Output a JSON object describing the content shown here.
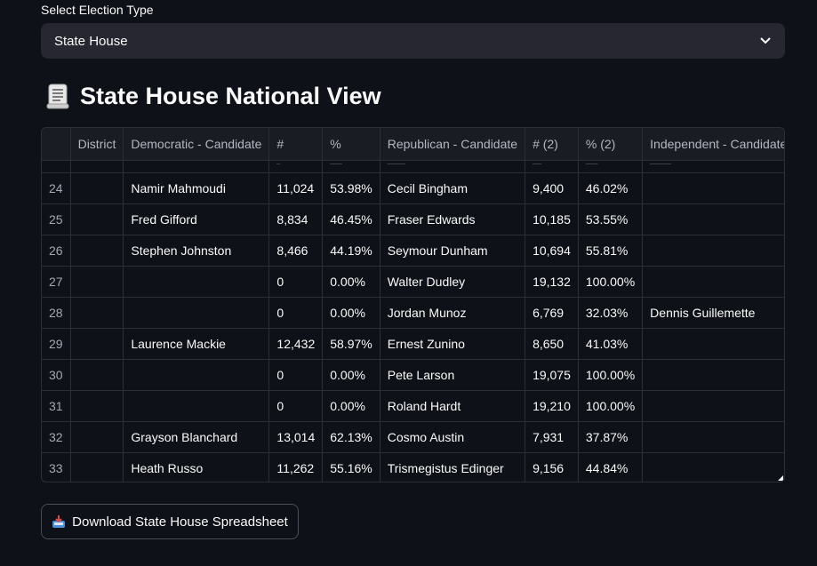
{
  "election_select": {
    "label": "Select Election Type",
    "value": "State House",
    "icon": "chevron-down-icon"
  },
  "heading": {
    "icon": "scroll-icon",
    "title": "State House National View"
  },
  "table": {
    "columns": [
      "",
      "District",
      "Democratic - Candidate",
      "#",
      "%",
      "Republican - Candidate",
      "# (2)",
      "% (2)",
      "Independent - Candidate"
    ],
    "rows": [
      {
        "idx": "24",
        "district": "",
        "dem": "Namir Mahmoudi",
        "dem_n": "11,024",
        "dem_p": "53.98%",
        "rep": "Cecil Bingham",
        "rep_n": "9,400",
        "rep_p": "46.02%",
        "ind": ""
      },
      {
        "idx": "25",
        "district": "",
        "dem": "Fred Gifford",
        "dem_n": "8,834",
        "dem_p": "46.45%",
        "rep": "Fraser Edwards",
        "rep_n": "10,185",
        "rep_p": "53.55%",
        "ind": ""
      },
      {
        "idx": "26",
        "district": "",
        "dem": "Stephen Johnston",
        "dem_n": "8,466",
        "dem_p": "44.19%",
        "rep": "Seymour Dunham",
        "rep_n": "10,694",
        "rep_p": "55.81%",
        "ind": ""
      },
      {
        "idx": "27",
        "district": "",
        "dem": "",
        "dem_n": "0",
        "dem_p": "0.00%",
        "rep": "Walter Dudley",
        "rep_n": "19,132",
        "rep_p": "100.00%",
        "ind": ""
      },
      {
        "idx": "28",
        "district": "",
        "dem": "",
        "dem_n": "0",
        "dem_p": "0.00%",
        "rep": "Jordan Munoz",
        "rep_n": "6,769",
        "rep_p": "32.03%",
        "ind": "Dennis Guillemette"
      },
      {
        "idx": "29",
        "district": "",
        "dem": "Laurence Mackie",
        "dem_n": "12,432",
        "dem_p": "58.97%",
        "rep": "Ernest Zunino",
        "rep_n": "8,650",
        "rep_p": "41.03%",
        "ind": ""
      },
      {
        "idx": "30",
        "district": "",
        "dem": "",
        "dem_n": "0",
        "dem_p": "0.00%",
        "rep": "Pete Larson",
        "rep_n": "19,075",
        "rep_p": "100.00%",
        "ind": ""
      },
      {
        "idx": "31",
        "district": "",
        "dem": "",
        "dem_n": "0",
        "dem_p": "0.00%",
        "rep": "Roland Hardt",
        "rep_n": "19,210",
        "rep_p": "100.00%",
        "ind": ""
      },
      {
        "idx": "32",
        "district": "",
        "dem": "Grayson Blanchard",
        "dem_n": "13,014",
        "dem_p": "62.13%",
        "rep": "Cosmo Austin",
        "rep_n": "7,931",
        "rep_p": "37.87%",
        "ind": ""
      },
      {
        "idx": "33",
        "district": "",
        "dem": "Heath Russo",
        "dem_n": "11,262",
        "dem_p": "55.16%",
        "rep": "Trismegistus Edinger",
        "rep_n": "9,156",
        "rep_p": "44.84%",
        "ind": ""
      }
    ]
  },
  "download": {
    "icon": "inbox-tray-icon",
    "label": "Download State House Spreadsheet"
  }
}
